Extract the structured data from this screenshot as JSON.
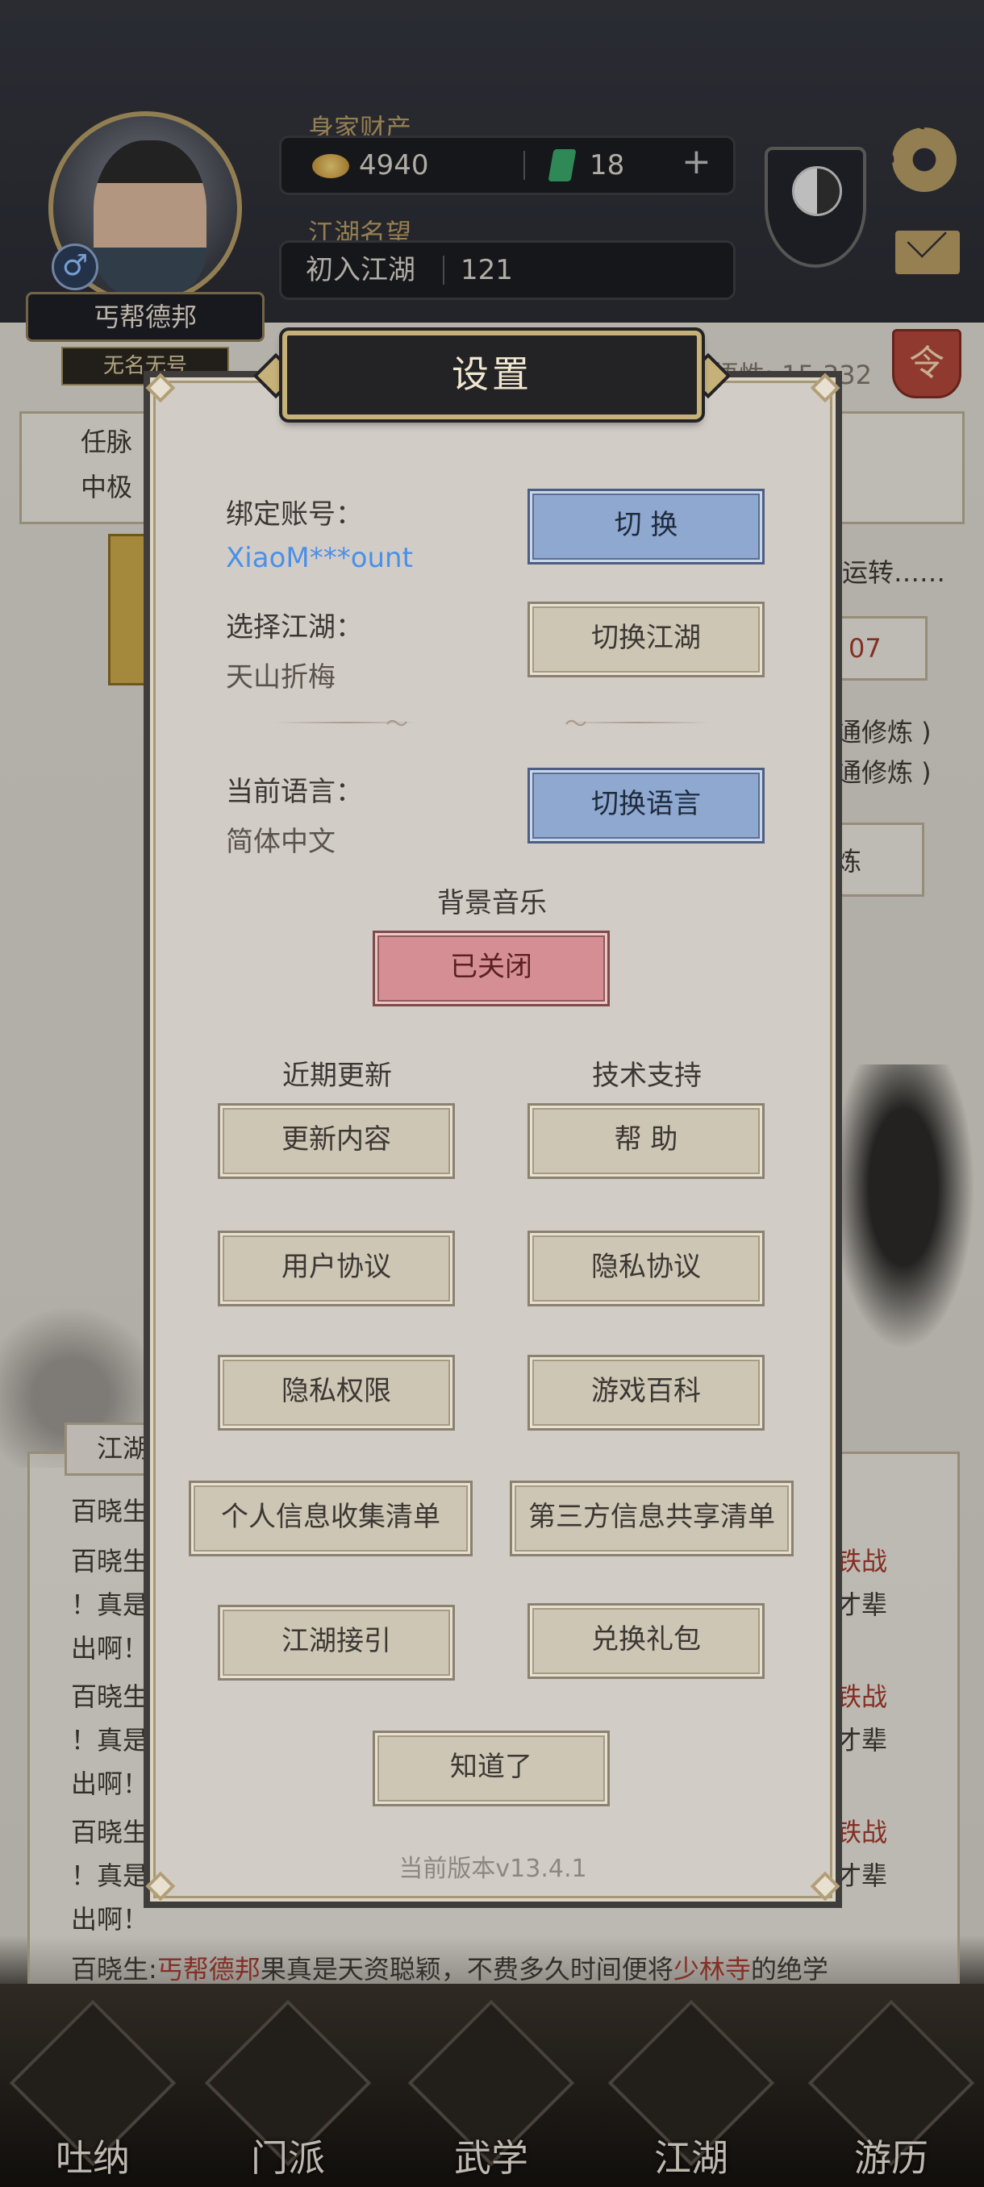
{
  "player": {
    "name": "丐帮德邦",
    "title": "无名无号",
    "gender_icon": "male-icon"
  },
  "resources": {
    "wealth_label": "身家财产",
    "gold": "4940",
    "jade": "18",
    "reputation_label": "江湖名望",
    "reputation_rank": "初入江湖",
    "reputation_value": "121"
  },
  "background": {
    "wisdom_text": "悟性: 15,332",
    "order_badge": "令",
    "panel_left_line1": "任脉",
    "panel_left_line2": "中极",
    "running_text": "运转……",
    "counter_text": "07",
    "practice_line1": "通修炼 )",
    "practice_line2": "通修炼 )",
    "practice_btn": "炼",
    "log_tab": "江湖",
    "log_lines": [
      "百晓生",
      "百晓生",
      "！真是",
      "出啊！",
      "百晓生",
      "！真是",
      "出啊！",
      "百晓生",
      "！真是",
      "出啊！"
    ],
    "log_right_a": "铁战",
    "log_right_b": "才辈",
    "log_full_prefix": "百晓生:",
    "log_full_name": "丐帮德邦",
    "log_full_mid": "果真是天资聪颖，不费多久时间便将",
    "log_full_sect": "少林寺",
    "log_full_suffix": "的绝学"
  },
  "nav": [
    {
      "label": "吐纳",
      "icon": "gourd-icon"
    },
    {
      "label": "门派",
      "icon": "banner-icon"
    },
    {
      "label": "武学",
      "icon": "scroll-icon"
    },
    {
      "label": "江湖",
      "icon": "hat-icon"
    },
    {
      "label": "游历",
      "icon": "horse-icon"
    }
  ],
  "dialog": {
    "title": "设置",
    "account_label": "绑定账号：",
    "account_value": "XiaoM***ount",
    "switch_btn": "切 换",
    "world_label": "选择江湖：",
    "world_value": "天山折梅",
    "switch_world_btn": "切换江湖",
    "language_label": "当前语言：",
    "language_value": "简体中文",
    "switch_language_btn": "切换语言",
    "music_label": "背景音乐",
    "music_btn": "已关闭",
    "updates_label": "近期更新",
    "support_label": "技术支持",
    "update_content_btn": "更新内容",
    "help_btn": "帮 助",
    "user_agreement_btn": "用户协议",
    "privacy_agreement_btn": "隐私协议",
    "privacy_permission_btn": "隐私权限",
    "wiki_btn": "游戏百科",
    "personal_info_btn": "个人信息收集清单",
    "third_party_btn": "第三方信息共享清单",
    "guide_btn": "江湖接引",
    "redeem_btn": "兑换礼包",
    "ok_btn": "知道了",
    "version": "当前版本v13.4.1"
  },
  "colors": {
    "link_blue": "#4a90e8",
    "button_blue": "#8ea8d0",
    "button_red": "#d58f94",
    "dialog_bg": "#d2ccc7"
  }
}
